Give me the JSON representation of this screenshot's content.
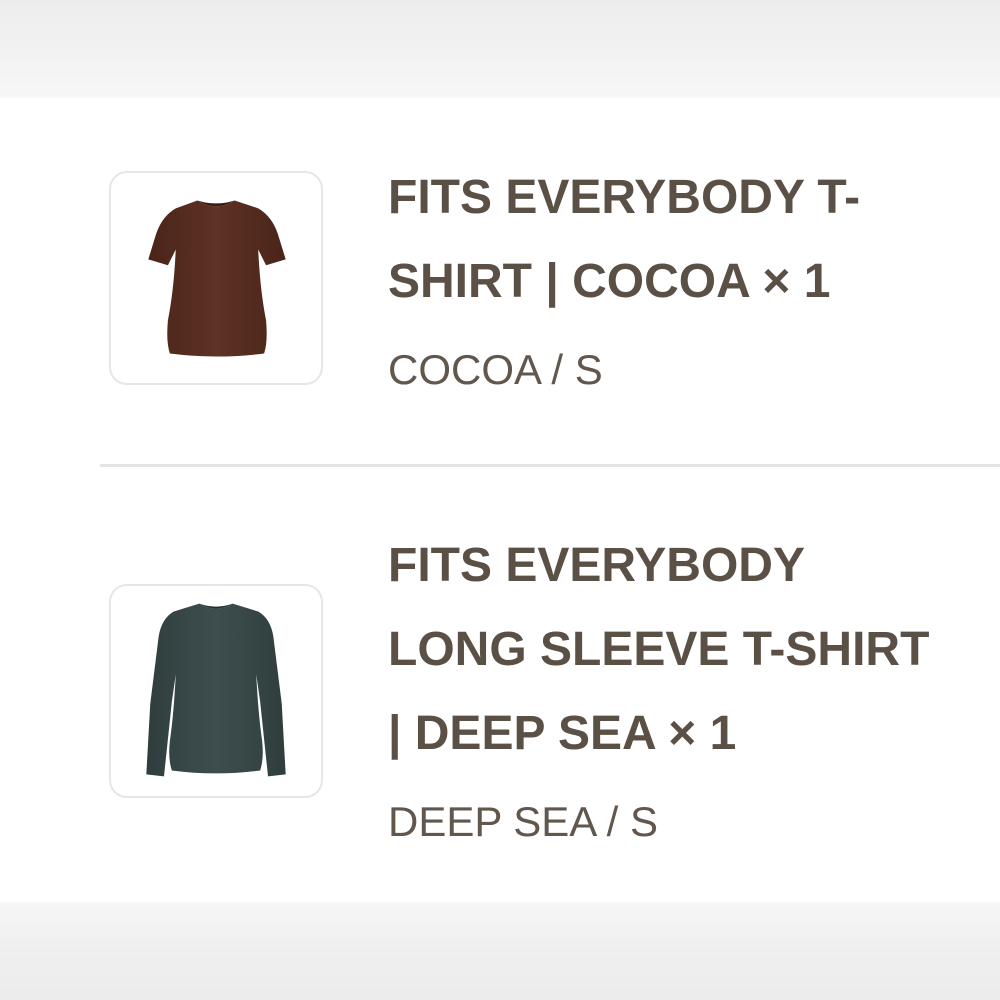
{
  "order_items": [
    {
      "title_lines": [
        "FITS EVERYBODY T-",
        "SHIRT | COCOA × 1"
      ],
      "variant": "COCOA / S",
      "image_icon": "short-sleeve-tshirt-icon",
      "garment_color": "#5a2f22"
    },
    {
      "title_lines": [
        "FITS EVERYBODY",
        "LONG SLEEVE T-SHIRT",
        "| DEEP SEA × 1"
      ],
      "variant": "DEEP SEA / S",
      "image_icon": "long-sleeve-tshirt-icon",
      "garment_color": "#3b4a4a"
    }
  ],
  "colors": {
    "title_text": "#5b5046",
    "variant_text": "#62574d",
    "divider": "#e4e4e4"
  }
}
